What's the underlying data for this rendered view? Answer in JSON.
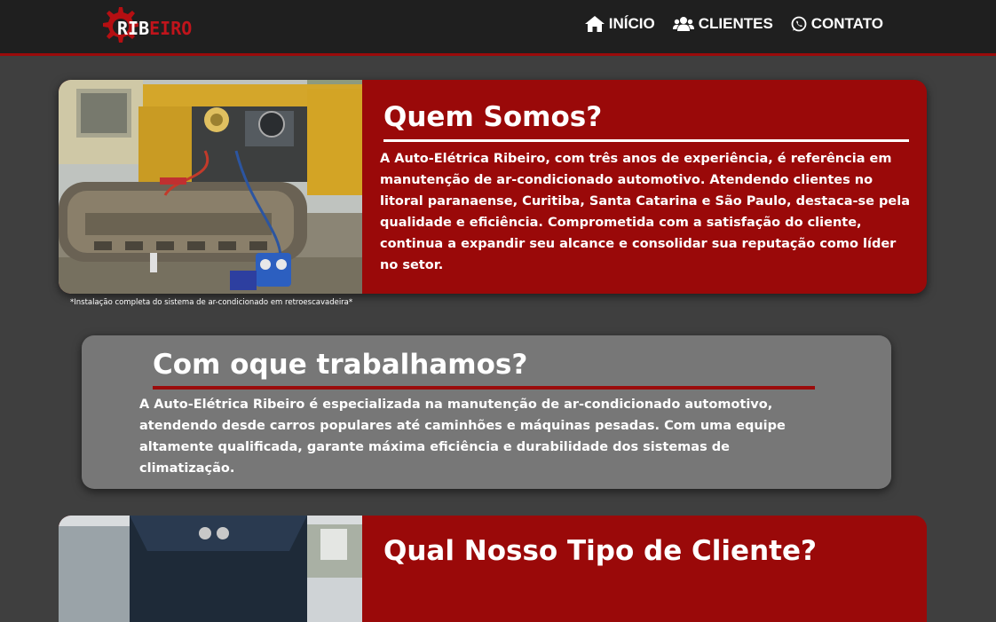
{
  "header": {
    "logo": {
      "text_white": "RIB",
      "text_red": "EIRO",
      "icon": "gear-icon"
    },
    "nav": [
      {
        "label": "INÍCIO",
        "icon": "home-icon"
      },
      {
        "label": "CLIENTES",
        "icon": "users-icon"
      },
      {
        "label": "CONTATO",
        "icon": "whatsapp-icon"
      }
    ]
  },
  "about": {
    "title": "Quem Somos?",
    "body": "A Auto-Elétrica Ribeiro, com três anos de experiência, é referência em manutenção de ar-condicionado automotivo. Atendendo clientes no litoral paranaense, Curitiba, Santa Catarina e São Paulo, destaca-se pela qualidade e eficiência. Comprometida com a satisfação do cliente, continua a expandir seu alcance e consolidar sua reputação como líder no setor.",
    "caption": "*Instalação completa do sistema de ar-condicionado em retroescavadeira*"
  },
  "work": {
    "title": "Com oque trabalhamos?",
    "body": "A Auto-Elétrica Ribeiro é especializada na manutenção de ar-condicionado automotivo, atendendo desde carros populares até caminhões e máquinas pesadas. Com uma equipe altamente qualificada, garante máxima eficiência e durabilidade dos sistemas de climatização."
  },
  "clients": {
    "title": "Qual Nosso Tipo de Cliente?"
  },
  "colors": {
    "brand_red": "#9a0909",
    "navbar": "#1f1f1f",
    "background": "#3f3f3f",
    "card_gray": "#777777"
  }
}
